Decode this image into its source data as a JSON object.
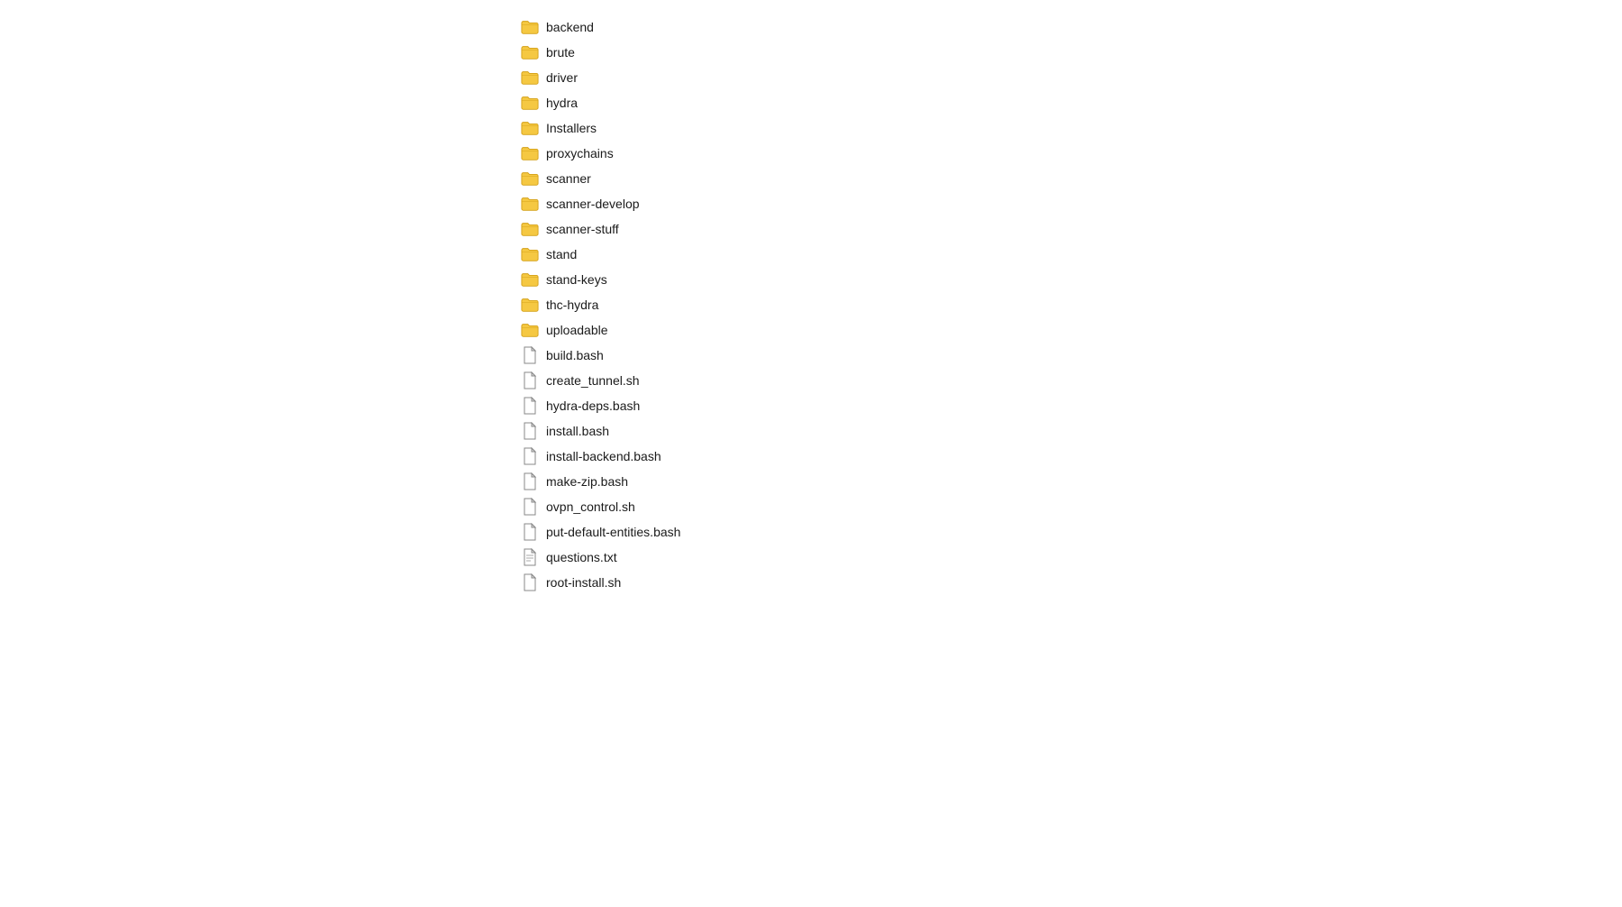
{
  "fileList": {
    "items": [
      {
        "name": "backend",
        "type": "folder"
      },
      {
        "name": "brute",
        "type": "folder"
      },
      {
        "name": "driver",
        "type": "folder"
      },
      {
        "name": "hydra",
        "type": "folder"
      },
      {
        "name": "Installers",
        "type": "folder"
      },
      {
        "name": "proxychains",
        "type": "folder"
      },
      {
        "name": "scanner",
        "type": "folder"
      },
      {
        "name": "scanner-develop",
        "type": "folder"
      },
      {
        "name": "scanner-stuff",
        "type": "folder"
      },
      {
        "name": "stand",
        "type": "folder"
      },
      {
        "name": "stand-keys",
        "type": "folder"
      },
      {
        "name": "thc-hydra",
        "type": "folder"
      },
      {
        "name": "uploadable",
        "type": "folder"
      },
      {
        "name": "build.bash",
        "type": "file"
      },
      {
        "name": "create_tunnel.sh",
        "type": "file"
      },
      {
        "name": "hydra-deps.bash",
        "type": "file"
      },
      {
        "name": "install.bash",
        "type": "file"
      },
      {
        "name": "install-backend.bash",
        "type": "file"
      },
      {
        "name": "make-zip.bash",
        "type": "file"
      },
      {
        "name": "ovpn_control.sh",
        "type": "file"
      },
      {
        "name": "put-default-entities.bash",
        "type": "file"
      },
      {
        "name": "questions.txt",
        "type": "file-lines"
      },
      {
        "name": "root-install.sh",
        "type": "file"
      }
    ]
  },
  "colors": {
    "folderFill": "#F5C518",
    "folderStroke": "#E6A800",
    "folderTab": "#F5C518",
    "fileBody": "#ffffff",
    "fileStroke": "#888888",
    "fileLines": "#aaaaaa"
  }
}
